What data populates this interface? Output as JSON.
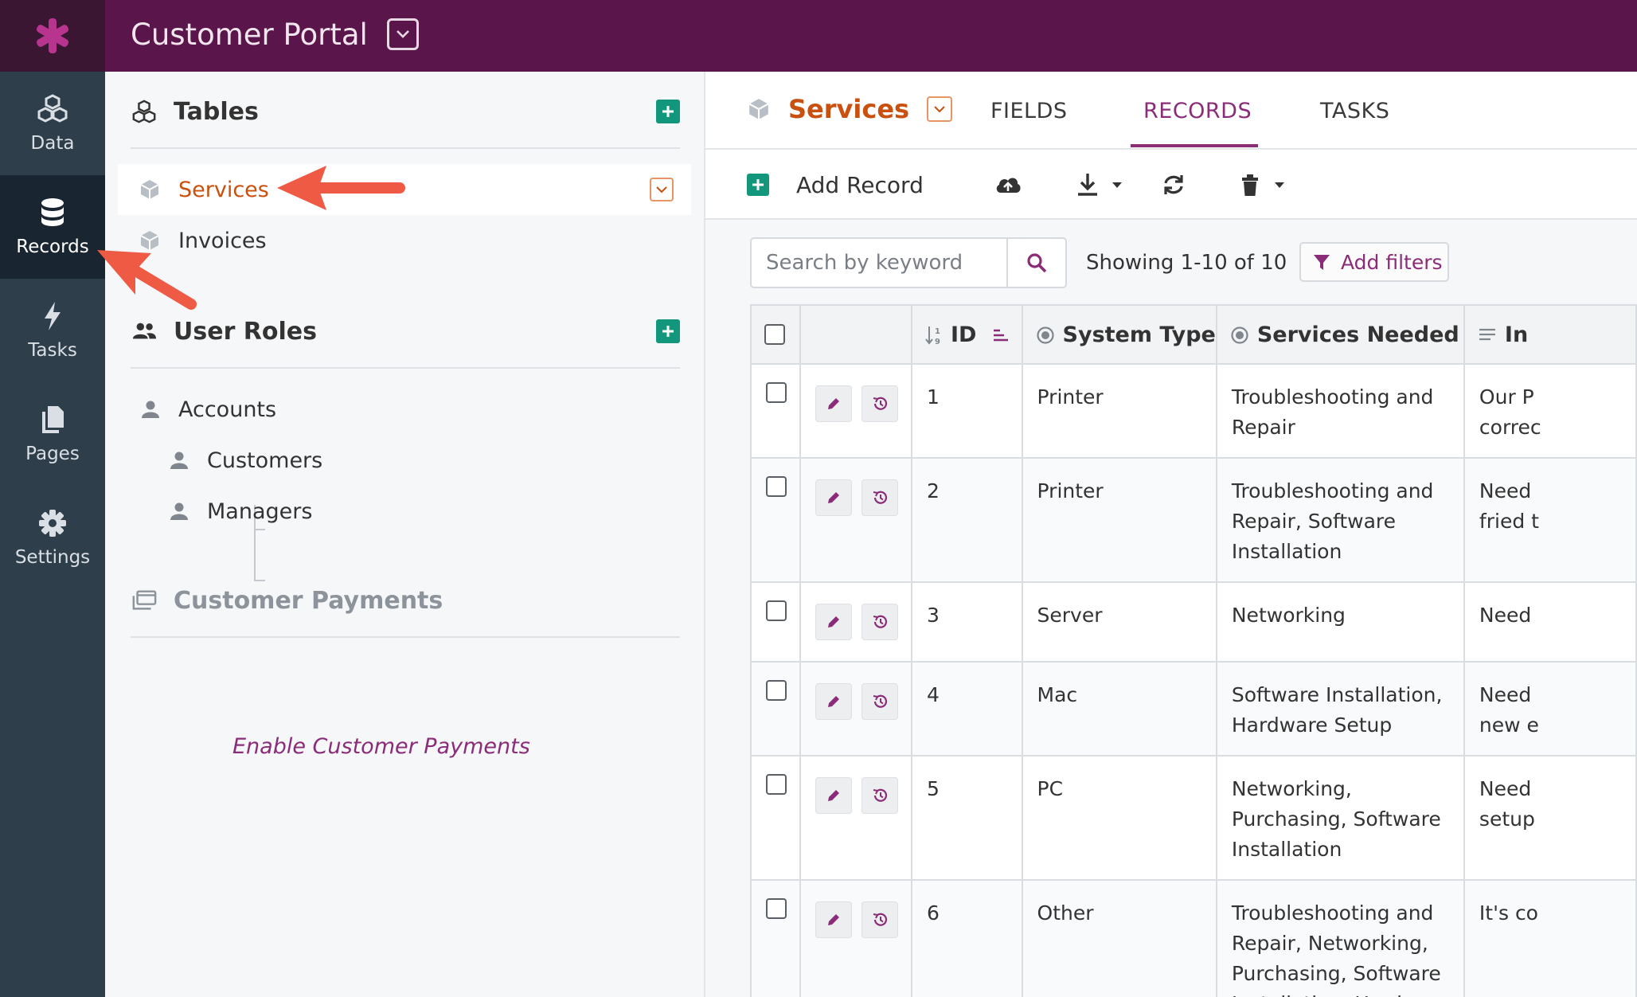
{
  "header": {
    "app_title": "Customer Portal"
  },
  "rail": [
    {
      "label": "Data",
      "icon": "cubes-icon"
    },
    {
      "label": "Records",
      "icon": "database-icon"
    },
    {
      "label": "Tasks",
      "icon": "bolt-icon"
    },
    {
      "label": "Pages",
      "icon": "pages-icon"
    },
    {
      "label": "Settings",
      "icon": "gear-icon"
    }
  ],
  "sidebar": {
    "tables_heading": "Tables",
    "tables": [
      {
        "label": "Services",
        "selected": true
      },
      {
        "label": "Invoices",
        "selected": false
      }
    ],
    "user_roles_heading": "User Roles",
    "roles": [
      {
        "label": "Accounts"
      },
      {
        "label": "Customers"
      },
      {
        "label": "Managers"
      }
    ],
    "payments_heading": "Customer Payments",
    "enable_payments": "Enable Customer Payments"
  },
  "main": {
    "object_title": "Services",
    "tabs": [
      {
        "label": "FIELDS",
        "active": false
      },
      {
        "label": "RECORDS",
        "active": true
      },
      {
        "label": "TASKS",
        "active": false
      }
    ],
    "toolbar": {
      "add_record": "Add Record"
    },
    "search": {
      "placeholder": "Search by keyword",
      "value": ""
    },
    "showing": "Showing 1-10 of 10",
    "add_filters": "Add filters"
  },
  "table": {
    "columns": [
      "ID",
      "System Type",
      "Services Needed",
      "In"
    ],
    "rows": [
      {
        "id": "1",
        "system_type": "Printer",
        "services": [
          "Troubleshooting and",
          "Repair"
        ],
        "issue": [
          "Our P",
          "correc"
        ]
      },
      {
        "id": "2",
        "system_type": "Printer",
        "services": [
          "Troubleshooting and",
          "Repair, Software",
          "Installation"
        ],
        "issue": [
          "Need",
          "fried t"
        ]
      },
      {
        "id": "3",
        "system_type": "Server",
        "services": [
          "Networking"
        ],
        "issue": [
          "Need"
        ]
      },
      {
        "id": "4",
        "system_type": "Mac",
        "services": [
          "Software Installation,",
          "Hardware Setup"
        ],
        "issue": [
          "Need",
          "new e"
        ]
      },
      {
        "id": "5",
        "system_type": "PC",
        "services": [
          "Networking,",
          "Purchasing, Software",
          "Installation"
        ],
        "issue": [
          "Need",
          "setup"
        ]
      },
      {
        "id": "6",
        "system_type": "Other",
        "services": [
          "Troubleshooting and",
          "Repair, Networking,",
          "Purchasing, Software",
          "Installation, Hardware"
        ],
        "issue": [
          "It's co"
        ]
      }
    ]
  },
  "colors": {
    "header_bg": "#5a164a",
    "rail_bg": "#2f3e4b",
    "accent_orange": "#c9500e",
    "accent_purple": "#8b2c79",
    "add_green": "#12977d",
    "annotation_arrow": "#ef5a44"
  }
}
